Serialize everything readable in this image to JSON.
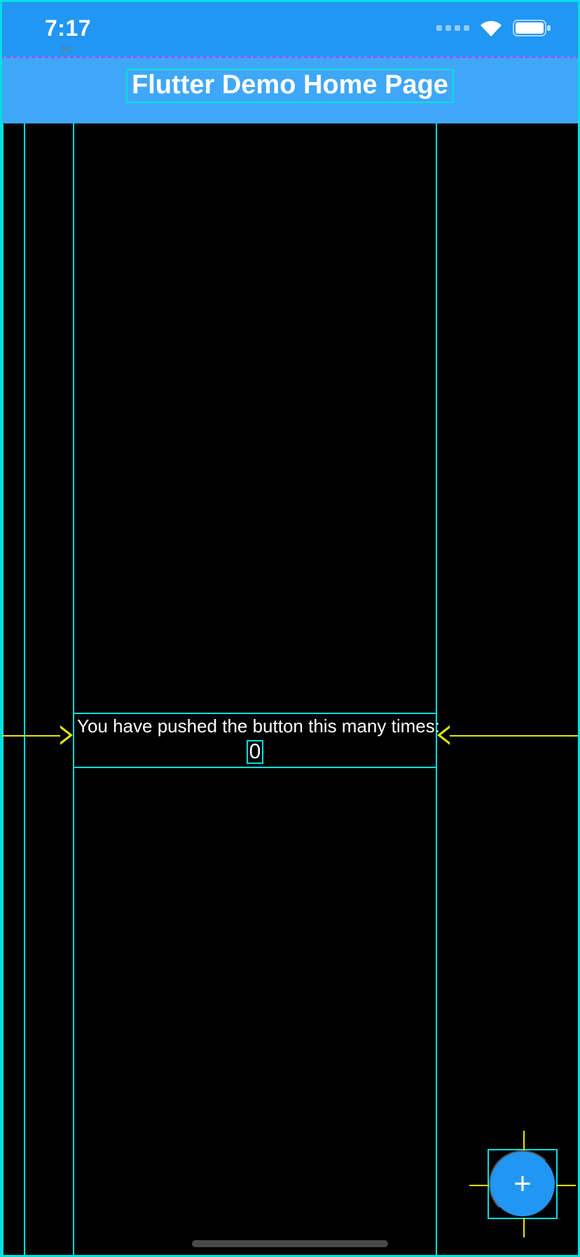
{
  "status": {
    "time": "7:17"
  },
  "appbar": {
    "title": "Flutter Demo Home Page"
  },
  "body": {
    "label": "You have pushed the button this many times:",
    "counter": "0"
  },
  "fab": {
    "icon_label": "+"
  },
  "colors": {
    "primary": "#2196f3",
    "guide": "#00e0e0",
    "arrow": "#e6e600",
    "dash": "#8a2be2"
  }
}
